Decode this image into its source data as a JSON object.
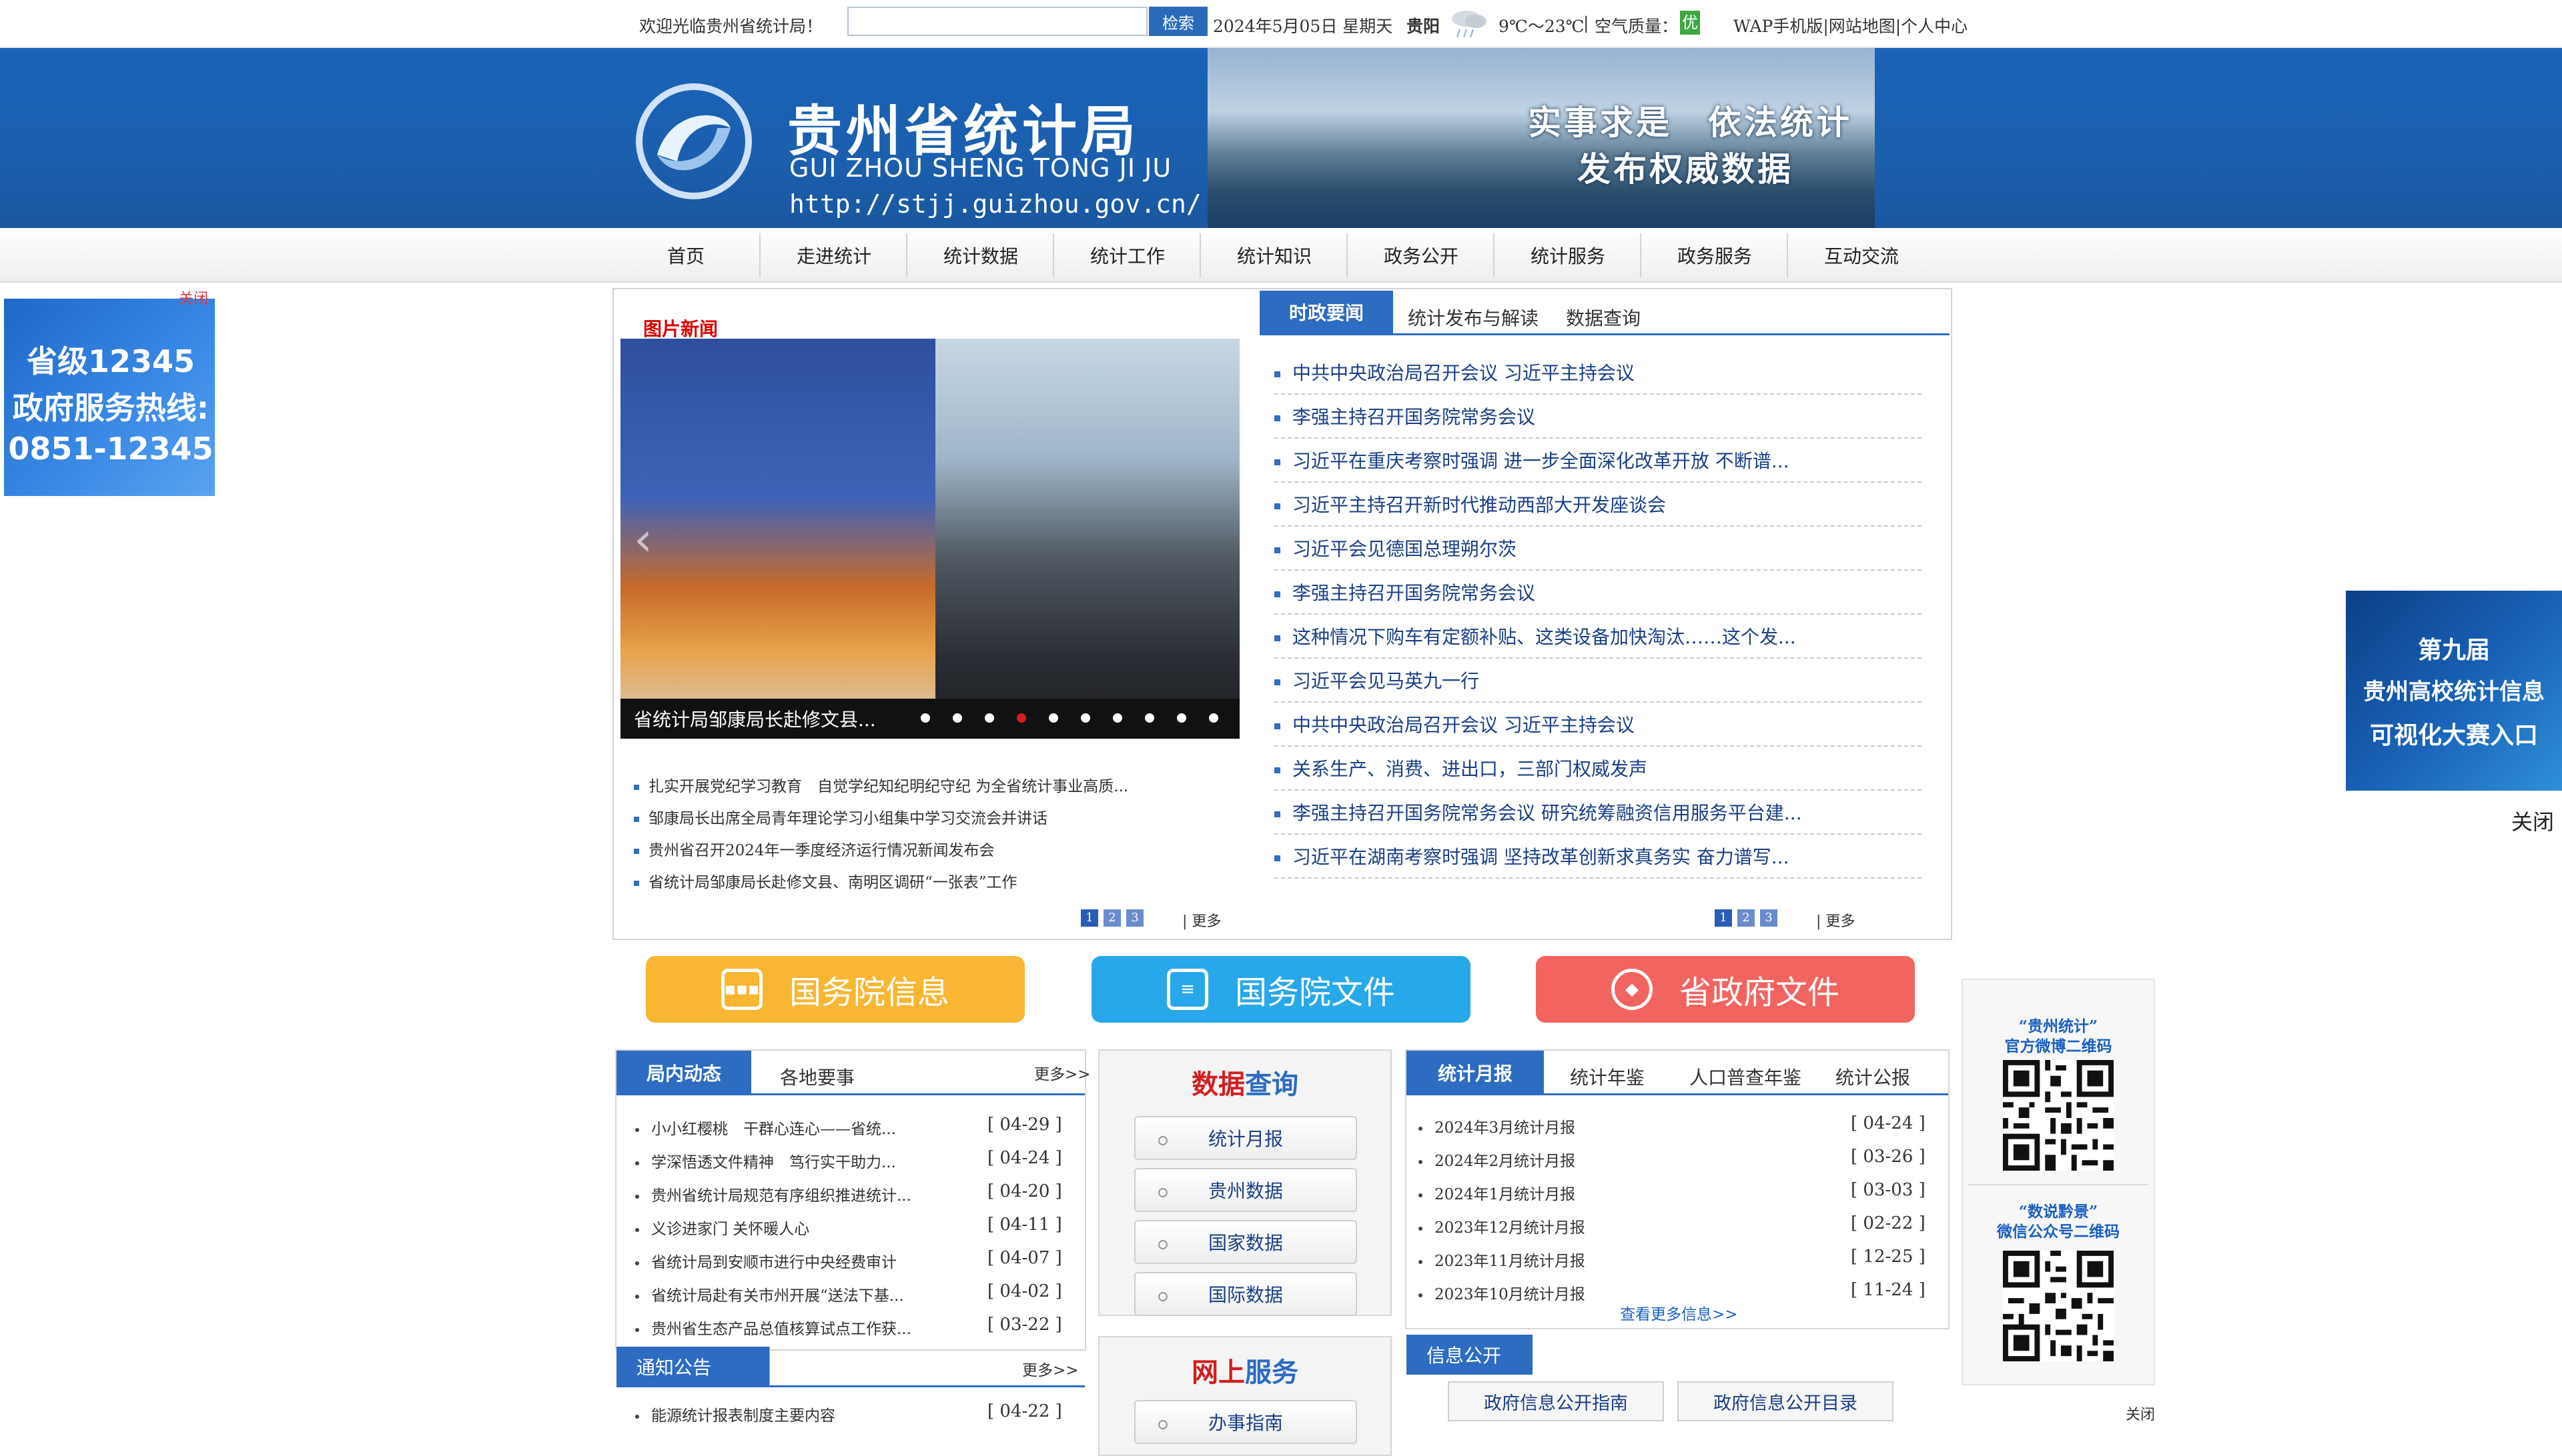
{
  "topbar": {
    "welcome": "欢迎光临贵州省统计局！",
    "search_placeholder": "",
    "search_button": "检索",
    "date": "2024年5月05日 星期天",
    "city": "贵阳",
    "temperature": "9℃～23℃",
    "aq_label": "空气质量：",
    "aq_value": "优",
    "links": "WAP手机版|网站地图|个人中心"
  },
  "banner": {
    "title": "贵州省统计局",
    "pinyin": "GUI ZHOU SHENG TONG JI JU",
    "url": "http://stjj.guizhou.gov.cn/",
    "slogan1": "实事求是　依法统计",
    "slogan2": "发布权威数据"
  },
  "nav": [
    "首页",
    "走进统计",
    "统计数据",
    "统计工作",
    "统计知识",
    "政务公开",
    "统计服务",
    "政务服务",
    "互动交流"
  ],
  "ad_left": {
    "close": "关闭",
    "line1": "省级12345",
    "line2": "政府服务热线:",
    "line3": "0851-12345"
  },
  "ad_right": {
    "close": "关闭",
    "line1": "第九届",
    "line2": "贵州高校统计信息",
    "line3": "可视化大赛入口"
  },
  "pic_news": {
    "title": "图片新闻",
    "caption": "省统计局邹康局长赴修文县...",
    "list": [
      "扎实开展党纪学习教育　自觉学纪知纪明纪守纪 为全省统计事业高质...",
      "邹康局长出席全局青年理论学习小组集中学习交流会并讲话",
      "贵州省召开2024年一季度经济运行情况新闻发布会",
      "省统计局邹康局长赴修文县、南明区调研“一张表”工作"
    ],
    "pages": [
      "1",
      "2",
      "3"
    ],
    "more": "| 更多"
  },
  "politics": {
    "tabs": [
      "时政要闻",
      "统计发布与解读",
      "数据查询"
    ],
    "items": [
      "中共中央政治局召开会议 习近平主持会议",
      "李强主持召开国务院常务会议",
      "习近平在重庆考察时强调 进一步全面深化改革开放 不断谱...",
      "习近平主持召开新时代推动西部大开发座谈会",
      "习近平会见德国总理朔尔茨",
      "李强主持召开国务院常务会议",
      "这种情况下购车有定额补贴、这类设备加快淘汰……这个发...",
      "习近平会见马英九一行",
      "中共中央政治局召开会议 习近平主持会议",
      "关系生产、消费、进出口，三部门权威发声",
      "李强主持召开国务院常务会议 研究统筹融资信用服务平台建...",
      "习近平在湖南考察时强调 坚持改革创新求真务实 奋力谱写..."
    ],
    "pages": [
      "1",
      "2",
      "3"
    ],
    "more": "| 更多"
  },
  "big_buttons": [
    {
      "label": "国务院信息",
      "color": "#f9b633",
      "icon": "chat-icon"
    },
    {
      "label": "国务院文件",
      "color": "#28a8ea",
      "icon": "document-icon"
    },
    {
      "label": "省政府文件",
      "color": "#f2645f",
      "icon": "layers-icon"
    }
  ],
  "local_news": {
    "tabs": [
      "局内动态",
      "各地要事"
    ],
    "more": "更多>>",
    "items": [
      {
        "title": "小小红樱桃　干群心连心——省统...",
        "date": "[ 04-29 ]"
      },
      {
        "title": "学深悟透文件精神　笃行实干助力...",
        "date": "[ 04-24 ]"
      },
      {
        "title": "贵州省统计局规范有序组织推进统计...",
        "date": "[ 04-20 ]"
      },
      {
        "title": "义诊进家门 关怀暖人心",
        "date": "[ 04-11 ]"
      },
      {
        "title": "省统计局到安顺市进行中央经费审计",
        "date": "[ 04-07 ]"
      },
      {
        "title": "省统计局赴有关市州开展“送法下基...",
        "date": "[ 04-02 ]"
      },
      {
        "title": "贵州省生态产品总值核算试点工作获...",
        "date": "[ 03-22 ]"
      }
    ]
  },
  "notice": {
    "tab": "通知公告",
    "more": "更多>>",
    "items": [
      {
        "title": "能源统计报表制度主要内容",
        "date": "[ 04-22 ]"
      }
    ]
  },
  "data_query": {
    "title_a": "数据",
    "title_b": "查询",
    "buttons": [
      "统计月报",
      "贵州数据",
      "国家数据",
      "国际数据"
    ]
  },
  "online_service": {
    "title_a": "网上",
    "title_b": "服务",
    "buttons": [
      "办事指南"
    ]
  },
  "monthly": {
    "tabs": [
      "统计月报",
      "统计年鉴",
      "人口普查年鉴",
      "统计公报"
    ],
    "items": [
      {
        "title": "2024年3月统计月报",
        "date": "[ 04-24 ]"
      },
      {
        "title": "2024年2月统计月报",
        "date": "[ 03-26 ]"
      },
      {
        "title": "2024年1月统计月报",
        "date": "[ 03-03 ]"
      },
      {
        "title": "2023年12月统计月报",
        "date": "[ 02-22 ]"
      },
      {
        "title": "2023年11月统计月报",
        "date": "[ 12-25 ]"
      },
      {
        "title": "2023年10月统计月报",
        "date": "[ 11-24 ]"
      }
    ],
    "more": "查看更多信息>>"
  },
  "info_open": {
    "tab": "信息公开",
    "buttons": [
      "政府信息公开指南",
      "政府信息公开目录"
    ]
  },
  "qr_panel": {
    "weibo_line1": "“贵州统计”",
    "weibo_line2": "官方微博二维码",
    "wechat_line1": "“数说黔景”",
    "wechat_line2": "微信公众号二维码",
    "close": "关闭"
  }
}
